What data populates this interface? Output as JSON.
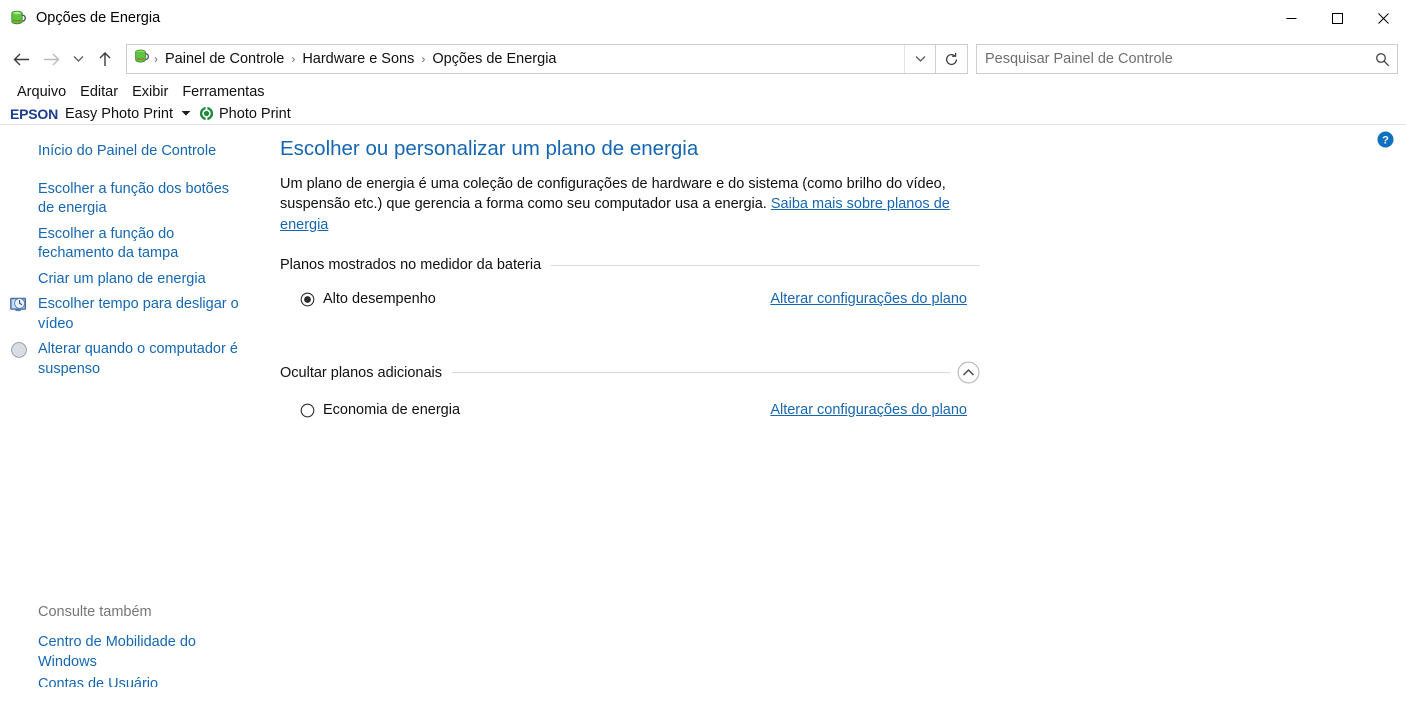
{
  "window": {
    "title": "Opções de Energia",
    "icon": "power-battery-icon",
    "controls": {
      "minimize": "Minimizar",
      "maximize": "Maximizar",
      "close": "Fechar"
    }
  },
  "navbar": {
    "back": "Voltar",
    "forward": "Avançar",
    "recent_locations": "Locais recentes",
    "up": "Acima",
    "breadcrumbs": [
      "Painel de Controle",
      "Hardware e Sons",
      "Opções de Energia"
    ],
    "separator": "›",
    "dropdown": "Histórico de locais anteriores",
    "refresh": "Atualizar",
    "search": {
      "placeholder": "Pesquisar Painel de Controle",
      "value": "",
      "icon": "search-icon"
    }
  },
  "menubar": {
    "items": [
      "Arquivo",
      "Editar",
      "Exibir",
      "Ferramentas"
    ]
  },
  "epson_toolbar": {
    "logo": "EPSON",
    "label": "Easy Photo Print",
    "caret": "▾",
    "photo_print": "Photo Print",
    "photo_print_icon": "epson-photo-print-icon"
  },
  "sidebar": {
    "home": "Início do Painel de Controle",
    "links": [
      {
        "label": "Escolher a função dos botões de energia",
        "icon": null
      },
      {
        "label": "Escolher a função do fechamento da tampa",
        "icon": null
      },
      {
        "label": "Criar um plano de energia",
        "icon": null
      },
      {
        "label": "Escolher tempo para desligar o vídeo",
        "icon": "monitor-clock-icon"
      },
      {
        "label": "Alterar quando o computador é suspenso",
        "icon": "sleep-moon-icon"
      }
    ],
    "see_also_title": "Consulte também",
    "see_also": [
      {
        "label": "Centro de Mobilidade do Windows",
        "clipped": false
      },
      {
        "label": "Contas de Usuário",
        "clipped": true
      }
    ]
  },
  "main": {
    "help_icon": "help-question-icon",
    "title": "Escolher ou personalizar um plano de energia",
    "intro_text_1": "Um plano de energia é uma coleção de configurações de hardware e do sistema (como brilho do vídeo, suspensão etc.) que gerencia a forma como seu computador usa a energia. ",
    "intro_link": "Saiba mais sobre planos de energia",
    "groups": [
      {
        "heading": "Planos mostrados no medidor da bateria",
        "collapsible": false,
        "plans": [
          {
            "name": "Alto desempenho",
            "selected": true,
            "link": "Alterar configurações do plano"
          }
        ]
      },
      {
        "heading": "Ocultar planos adicionais",
        "collapsible": true,
        "collapse_icon": "chevron-up-circle-icon",
        "plans": [
          {
            "name": "Economia de energia",
            "selected": false,
            "link": "Alterar configurações do plano"
          }
        ]
      }
    ]
  },
  "colors": {
    "link": "#1667b1",
    "heading": "#1667b1",
    "text": "#111111",
    "muted": "#767676",
    "rule": "#d9d9d9",
    "epson_blue": "#1b3d8f",
    "help_blue": "#1070c0"
  }
}
